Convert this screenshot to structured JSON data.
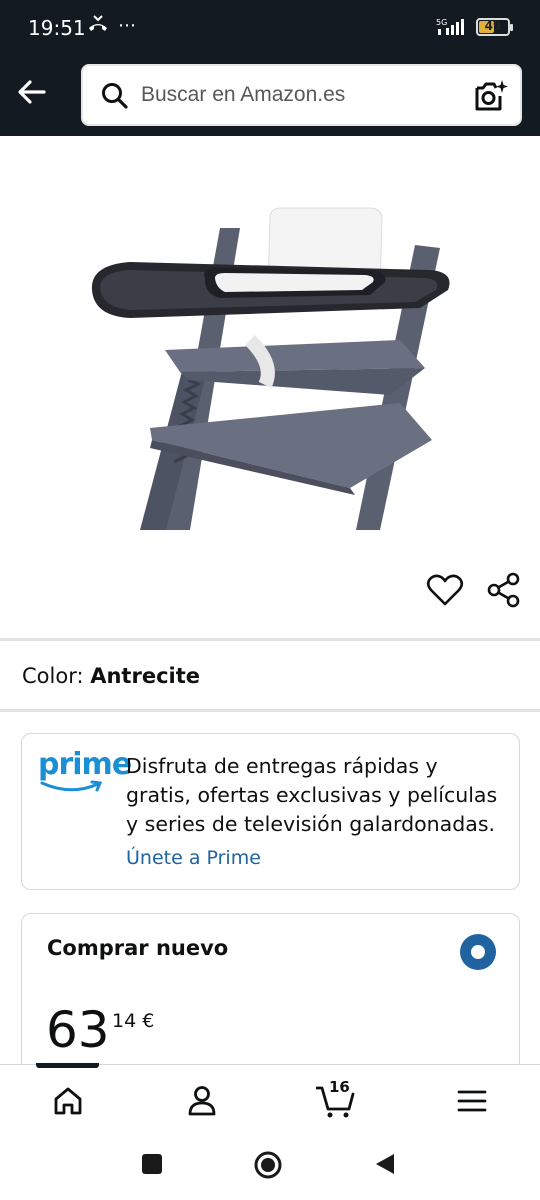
{
  "status_bar": {
    "time": "19:51",
    "extra_icons": "⋯",
    "network": "5G",
    "battery_level": "49"
  },
  "header": {
    "search_placeholder": "Buscar en Amazon.es",
    "icons": [
      "back-arrow-icon",
      "search-icon",
      "camera-search-icon"
    ]
  },
  "product": {
    "image_desc_icon": "high-chair-image",
    "actions": [
      "heart-icon",
      "share-icon"
    ]
  },
  "color": {
    "label": "Color:",
    "value": "Antrecite"
  },
  "prime": {
    "logo_text": "prime",
    "description": "Disfruta de entregas rápidas y gratis, ofertas exclusivas y películas y series de televisión galardonadas.",
    "link": "Únete a Prime",
    "accent": "#1b8ed6"
  },
  "buy": {
    "title": "Comprar nuevo",
    "price_whole": "63",
    "price_fraction": "14 €",
    "radio_color": "#2162a1"
  },
  "bottom_nav": {
    "items": [
      "home-icon",
      "account-icon",
      "cart-icon",
      "menu-icon"
    ],
    "cart_count": "16"
  },
  "colors": {
    "header_bg": "#131a22",
    "link": "#2162a1"
  }
}
